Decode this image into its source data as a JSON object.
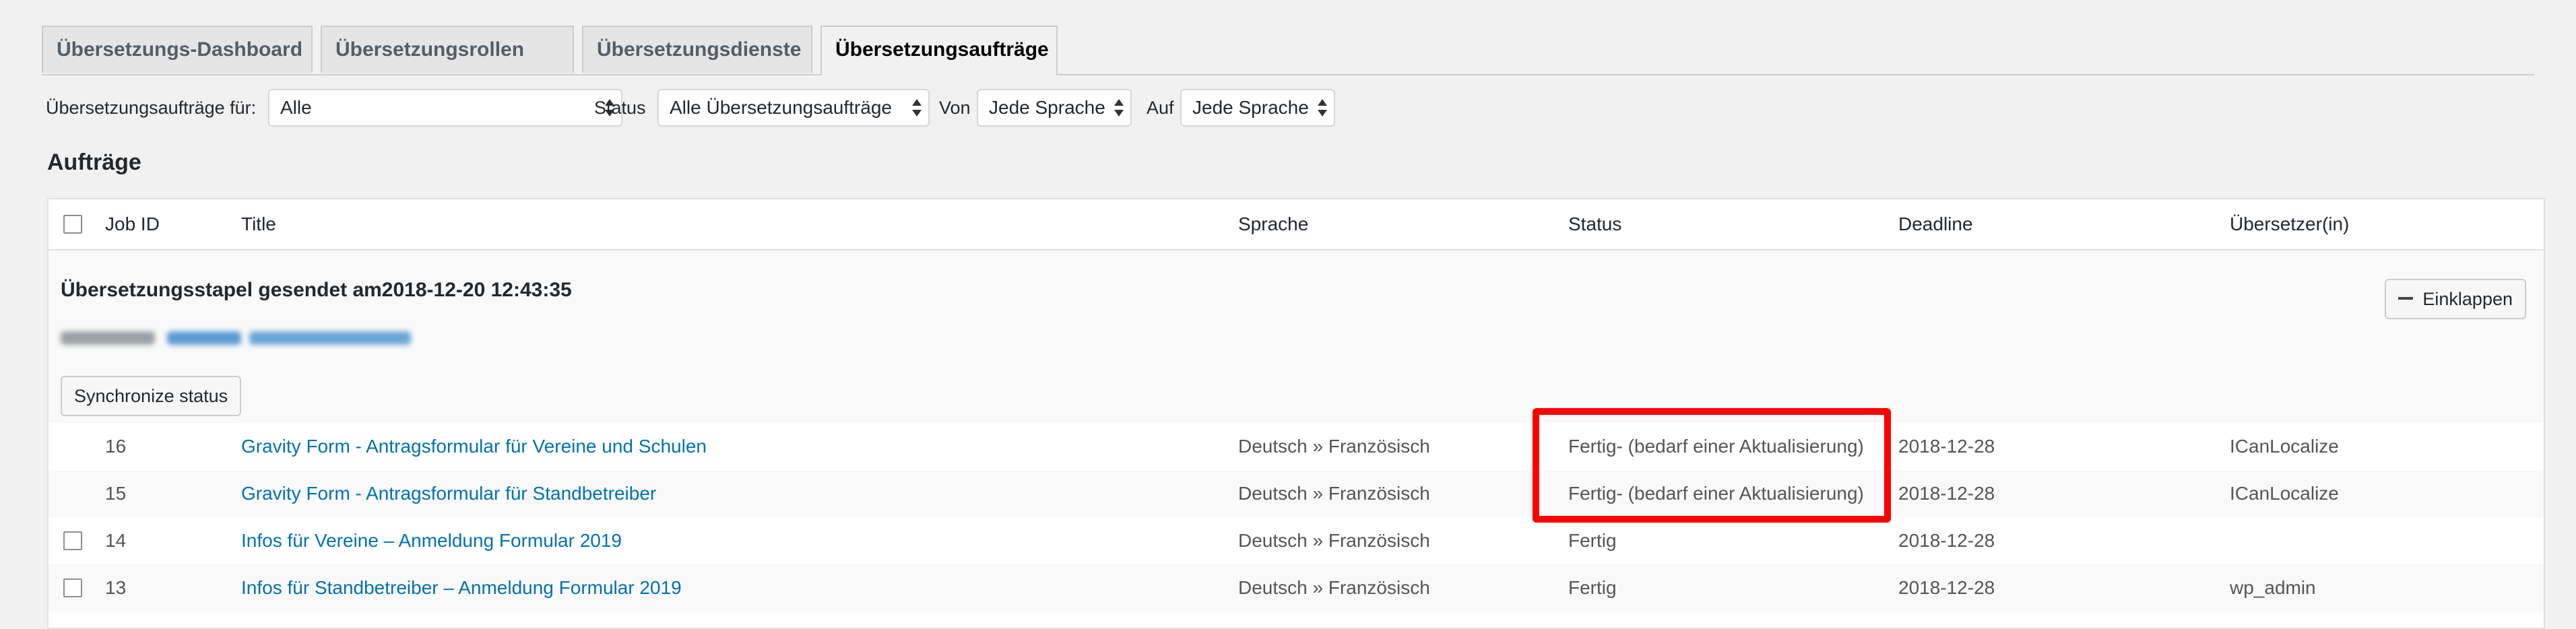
{
  "tabs": [
    {
      "label": "Übersetzungs-Dashboard"
    },
    {
      "label": "Übersetzungsrollen"
    },
    {
      "label": "Übersetzungsdienste"
    },
    {
      "label": "Übersetzungsaufträge"
    }
  ],
  "filters": {
    "for_label": "Übersetzungsaufträge für:",
    "for_value": "Alle",
    "status_label": "Status",
    "status_value": "Alle Übersetzungsaufträge",
    "from_label": "Von",
    "from_value": "Jede Sprache",
    "to_label": "Auf",
    "to_value": "Jede Sprache"
  },
  "section_title": "Aufträge",
  "table": {
    "headers": {
      "job_id": "Job ID",
      "title": "Title",
      "language": "Sprache",
      "status": "Status",
      "deadline": "Deadline",
      "translator": "Übersetzer(in)"
    },
    "batch": {
      "title": "Übersetzungsstapel gesendet am2018-12-20 12:43:35",
      "collapse_label": "Einklappen",
      "sync_label": "Synchronize status"
    },
    "rows": [
      {
        "id": "16",
        "title": "Gravity Form - Antragsformular für Vereine und Schulen",
        "language": "Deutsch » Französisch",
        "status": "Fertig- (bedarf einer Aktualisierung)",
        "deadline": "2018-12-28",
        "translator": "ICanLocalize"
      },
      {
        "id": "15",
        "title": "Gravity Form - Antragsformular für Standbetreiber",
        "language": "Deutsch » Französisch",
        "status": "Fertig- (bedarf einer Aktualisierung)",
        "deadline": "2018-12-28",
        "translator": "ICanLocalize"
      },
      {
        "id": "14",
        "title": "Infos für Vereine – Anmeldung Formular 2019",
        "language": "Deutsch » Französisch",
        "status": "Fertig",
        "deadline": "2018-12-28",
        "translator": ""
      },
      {
        "id": "13",
        "title": "Infos für Standbetreiber – Anmeldung Formular 2019",
        "language": "Deutsch » Französisch",
        "status": "Fertig",
        "deadline": "2018-12-28",
        "translator": "wp_admin"
      }
    ]
  },
  "colors": {
    "link": "#0073aa",
    "highlight": "#ff0000"
  }
}
